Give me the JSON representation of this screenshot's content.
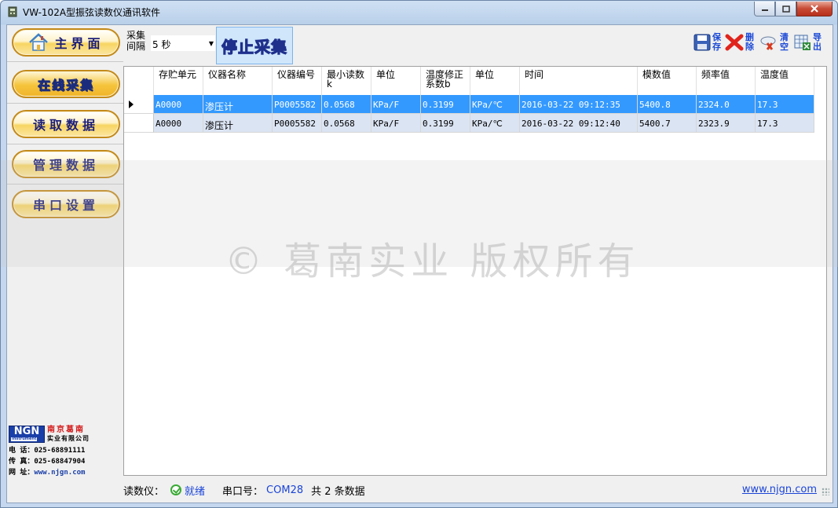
{
  "window": {
    "title": "VW-102A型振弦读数仪通讯软件"
  },
  "sidebar": {
    "items": [
      {
        "label": "主界面",
        "icon": "home-icon"
      },
      {
        "label": "在线采集"
      },
      {
        "label": "读取数据"
      },
      {
        "label": "管理数据"
      },
      {
        "label": "串口设置"
      }
    ],
    "company": {
      "logo_text": "NGN",
      "logo_sub": "Instrument",
      "name_line1": "南京葛南",
      "name_line2": "实业有限公司",
      "phone_label": "电 话：",
      "phone": "025-68891111",
      "fax_label": "传 真：",
      "fax": "025-68847904",
      "web_label": "网 址：",
      "web": "www.njgn.com"
    }
  },
  "toolbar": {
    "interval_label": "采集间隔",
    "interval_value": "5 秒",
    "stop_label": "停止采集",
    "save_label": "保存",
    "delete_label": "删除",
    "clear_label": "清空",
    "export_label": "导出"
  },
  "grid": {
    "columns": [
      "存贮单元",
      "仪器名称",
      "仪器编号",
      "最小读数k",
      "单位",
      "温度修正系数b",
      "单位",
      "时间",
      "模数值",
      "频率值",
      "温度值"
    ],
    "rows": [
      [
        "A0000",
        "渗压计",
        "P0005582",
        "0.0568",
        "KPa/F",
        "0.3199",
        "KPa/℃",
        "2016-03-22 09:12:35",
        "5400.8",
        "2324.0",
        "17.3"
      ],
      [
        "A0000",
        "渗压计",
        "P0005582",
        "0.0568",
        "KPa/F",
        "0.3199",
        "KPa/℃",
        "2016-03-22 09:12:40",
        "5400.7",
        "2323.9",
        "17.3"
      ]
    ],
    "selected_row": 0
  },
  "watermark": "©  葛南实业 版权所有",
  "status": {
    "device_label": "读数仪：",
    "device_state": "就绪",
    "port_label": "串口号：",
    "port_value": "COM28",
    "count_text": "共 2 条数据",
    "link": "www.njgn.com"
  },
  "colors": {
    "selection": "#3399ff",
    "alt_row": "#dbe4f3",
    "nav_gold": "#f8d562",
    "accent_blue": "#1a44d8"
  }
}
